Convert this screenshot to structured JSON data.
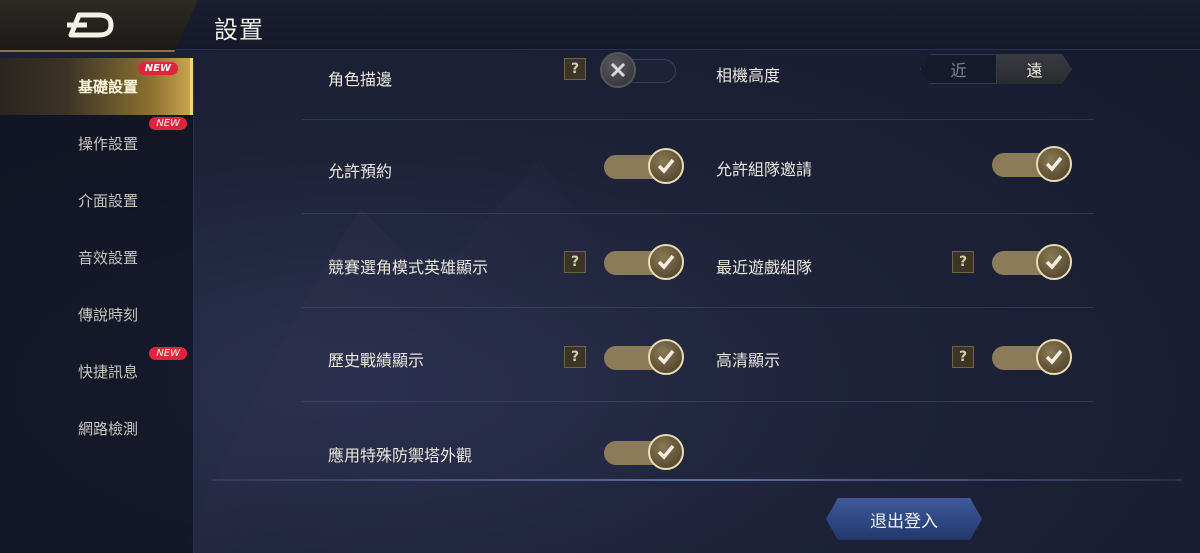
{
  "header": {
    "title": "設置",
    "back_icon": "back-arrow-icon"
  },
  "sidebar": {
    "items": [
      {
        "label": "基礎設置",
        "badge": "NEW",
        "active": true
      },
      {
        "label": "操作設置",
        "badge": "NEW",
        "active": false
      },
      {
        "label": "介面設置",
        "badge": "",
        "active": false
      },
      {
        "label": "音效設置",
        "badge": "",
        "active": false
      },
      {
        "label": "傳說時刻",
        "badge": "",
        "active": false
      },
      {
        "label": "快捷訊息",
        "badge": "NEW",
        "active": false
      },
      {
        "label": "網路檢測",
        "badge": "",
        "active": false
      }
    ]
  },
  "settings": {
    "outline": {
      "label": "角色描邊",
      "help": "?",
      "enabled": false
    },
    "camera_height": {
      "label": "相機高度",
      "options": [
        "近",
        "遠"
      ],
      "selected": "遠"
    },
    "allow_reservation": {
      "label": "允許預約",
      "enabled": true
    },
    "allow_team_invite": {
      "label": "允許組隊邀請",
      "enabled": true
    },
    "ranked_hero_display": {
      "label": "競賽選角模式英雄顯示",
      "help": "?",
      "enabled": true
    },
    "recent_team": {
      "label": "最近遊戲組隊",
      "help": "?",
      "enabled": true
    },
    "history_display": {
      "label": "歷史戰績顯示",
      "help": "?",
      "enabled": true
    },
    "hd_display": {
      "label": "高清顯示",
      "help": "?",
      "enabled": true
    },
    "special_tower": {
      "label": "應用特殊防禦塔外觀",
      "enabled": true
    }
  },
  "footer": {
    "logout_label": "退出登入"
  },
  "colors": {
    "accent_gold": "#c9a44e",
    "badge_red": "#e0243a",
    "logout_blue": "#2e4680"
  }
}
